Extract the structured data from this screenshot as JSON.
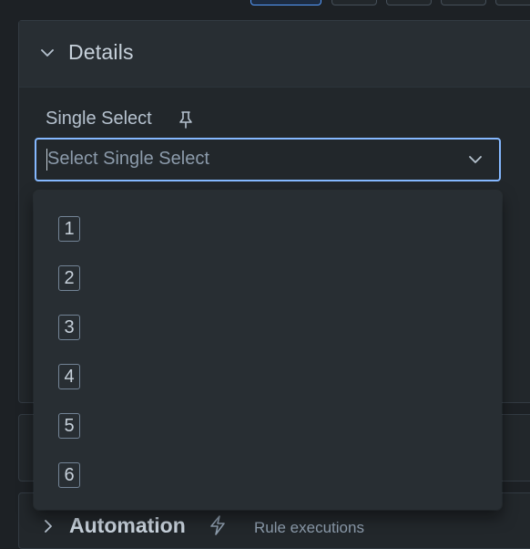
{
  "details": {
    "title": "Details",
    "field_label": "Single Select",
    "select_placeholder": "Select Single Select"
  },
  "options": [
    "1",
    "2",
    "3",
    "4",
    "5",
    "6"
  ],
  "automation": {
    "title": "Automation",
    "subtitle": "Rule executions"
  },
  "icons": {
    "collapse": "chevron-down-icon",
    "pin": "pin-icon",
    "select_caret": "chevron-down-icon",
    "expand": "chevron-right-icon",
    "automation": "lightning-bolt-icon"
  },
  "colors": {
    "background": "#1d2125",
    "panel": "#22272b",
    "focus_border": "#85b8ff",
    "active_button": "#579dff"
  }
}
